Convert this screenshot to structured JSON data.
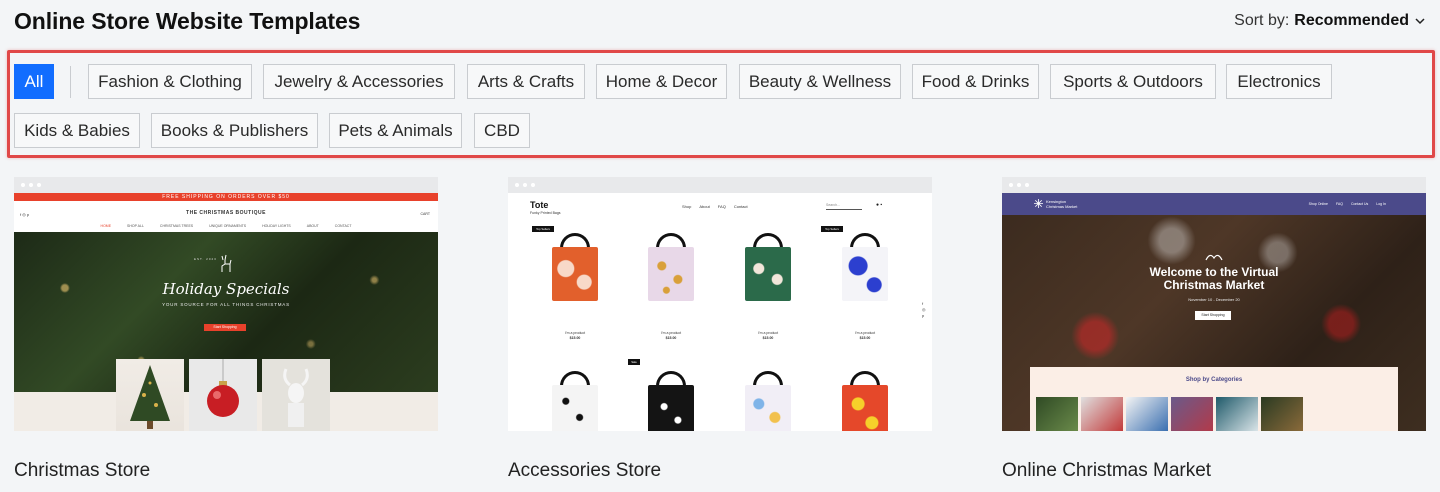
{
  "page": {
    "title": "Online Store Website Templates"
  },
  "sort": {
    "label": "Sort by:",
    "value": "Recommended"
  },
  "filters": {
    "active": "All",
    "row1": [
      "Fashion & Clothing",
      "Jewelry & Accessories",
      "Arts & Crafts",
      "Home & Decor",
      "Beauty & Wellness",
      "Food & Drinks",
      "Sports & Outdoors",
      "Electronics"
    ],
    "row2": [
      "Kids & Babies",
      "Books & Publishers",
      "Pets & Animals",
      "CBD"
    ]
  },
  "colors": {
    "accent": "#116dff",
    "highlight_border": "#e04848"
  },
  "templates": [
    {
      "name": "Christmas Store",
      "preview": {
        "banner": "FREE SHIPPING ON ORDERS OVER $50",
        "brand": "THE CHRISTMAS BOUTIQUE",
        "nav": [
          "HOME",
          "SHOP ALL",
          "CHRISTMAS TREES",
          "UNIQUE ORNAMENTS",
          "HOLIDAY LIGHTS",
          "ABOUT",
          "CONTACT"
        ],
        "est": "EST. 2023",
        "hero_title": "Holiday Specials",
        "hero_subtitle": "YOUR SOURCE FOR ALL THINGS CHRISTMAS",
        "hero_button": "Start Shopping",
        "cart": "CART"
      }
    },
    {
      "name": "Accessories Store",
      "preview": {
        "logo": "Tote",
        "tagline": "Funky Printed Bags",
        "nav": [
          "Shop",
          "About",
          "FAQ",
          "Contact"
        ],
        "search_placeholder": "Search...",
        "badge_top": "Top Sellers",
        "badge_sale": "Sale",
        "product_name": "I'm a product",
        "product_price": "$15.00"
      }
    },
    {
      "name": "Online Christmas Market",
      "preview": {
        "brand_line1": "Kensington",
        "brand_line2": "Christmas Market",
        "nav": [
          "Shop Online",
          "FAQ",
          "Contact Us",
          "Log In"
        ],
        "hero_title_line1": "Welcome to the Virtual",
        "hero_title_line2": "Christmas Market",
        "hero_dates": "November 10 - December 20",
        "hero_button": "Start Shopping",
        "panel_title": "Shop by Categories"
      }
    }
  ]
}
